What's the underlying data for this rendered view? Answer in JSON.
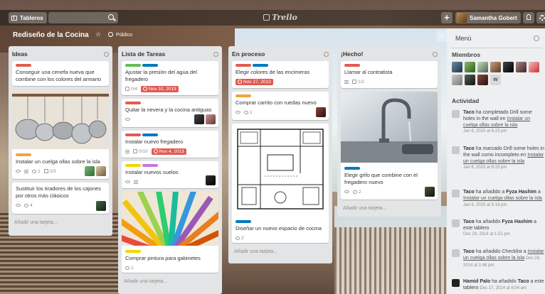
{
  "header": {
    "boards_label": "Tableros",
    "logo_text": "Trello",
    "add_label": "+",
    "user_name": "Samantha Gobert"
  },
  "board": {
    "title": "Rediseño de la Cocina",
    "visibility": "Público"
  },
  "lists": [
    {
      "title": "Ideas",
      "add_card": "Añadir una tarjeta...",
      "cards": [
        {
          "title": "Conseguir una cenefa nueva que combine con los colores del armario",
          "labels": [
            "#e15c4f"
          ]
        },
        {
          "title": "Instalar un cuelga ollas sobre la isla",
          "labels": [
            "#f2a53a"
          ],
          "comments": "1",
          "checklist": "2/3"
        },
        {
          "title": "Sustituir los tiradores de los cajones por otros más clásicos",
          "comments": "4"
        }
      ]
    },
    {
      "title": "Lista de Tareas",
      "add_card": "Añadir una tarjeta...",
      "cards": [
        {
          "title": "Ajustar la presión del agua del fregadero",
          "labels": [
            "#61bd4f",
            "#0079bf"
          ],
          "checklist": "0/4",
          "due": "Nov 10, 2013"
        },
        {
          "title": "Quitar la nevera y la cocina antiguas",
          "labels": [
            "#e15c4f"
          ]
        },
        {
          "title": "Instalar nuevo fregadero",
          "labels": [
            "#e15c4f",
            "#0079bf"
          ],
          "checklist": "0/10",
          "due": "Nov 4, 2013"
        },
        {
          "title": "Instalar nuevos suelos",
          "labels": [
            "#f2d600",
            "#c377e0"
          ]
        },
        {
          "title": "Comprar pintura para gabinetes",
          "labels": [
            "#f2d600"
          ],
          "comments": "1"
        }
      ]
    },
    {
      "title": "En proceso",
      "add_card": "Añadir una tarjeta...",
      "cards": [
        {
          "title": "Elegir colores de las encimeras",
          "labels": [
            "#e15c4f",
            "#0079bf"
          ],
          "due": "Nov 27, 2013"
        },
        {
          "title": "Comprar carrito con ruedas nuevo",
          "labels": [
            "#f2a53a"
          ],
          "comments": "1"
        },
        {
          "title": "Diseñar un nuevo espacio de cocina",
          "labels": [
            "#0079bf"
          ],
          "comments": "2"
        }
      ]
    },
    {
      "title": "¡Hecho!",
      "add_card": "Añadir una tarjeta...",
      "cards": [
        {
          "title": "Llamar al contratista",
          "labels": [
            "#e15c4f"
          ],
          "checklist": "1/2"
        },
        {
          "title": "Elegir grifo que combine con el fregadero nuevo",
          "labels": [
            "#0079bf"
          ],
          "comments": "2"
        }
      ]
    }
  ],
  "sidebar": {
    "menu_title": "Menú",
    "members_title": "Miembros",
    "extra_member": "W",
    "activity_title": "Actividad",
    "activity": [
      {
        "user": "Taco",
        "text": "ha completado Drill some holes in the wall en",
        "link": "Instalar un cuelga ollas sobre la isla",
        "date": "Jan 6, 2015 at 6:23 pm"
      },
      {
        "user": "Taco",
        "text": "ha marcado Drill some holes in the wall como incompleto en",
        "link": "Instalar un cuelga ollas sobre la isla",
        "date": "Jan 6, 2015 at 6:23 pm"
      },
      {
        "user": "Taco",
        "text": "ha añadido a",
        "target": "Fyza Hashim",
        "text2": "a",
        "link": "Instalar un cuelga ollas sobre la isla",
        "date": "Jan 6, 2015 at 6:19 pm"
      },
      {
        "user": "Taco",
        "text": "ha añadido",
        "target": "Fyza Hashim",
        "text2": "a este tablero",
        "date": "Dec 29, 2014 at 1:51 pm"
      },
      {
        "user": "Taco",
        "text": "ha añadido Checklist a",
        "link": "Instalar un cuelga ollas sobre la isla",
        "date": "Dec 29, 2014 at 1:48 pm"
      },
      {
        "user": "Hamid Palo",
        "text": "ha añadido",
        "target": "Taco",
        "text2": "a este tablero",
        "date": "Dec 17, 2014 at 6:04 am"
      }
    ]
  }
}
